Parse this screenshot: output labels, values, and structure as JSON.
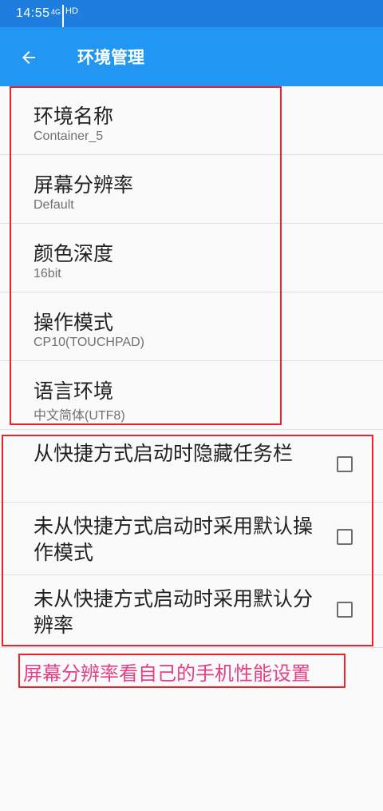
{
  "status_bar": {
    "time": "14:55",
    "network_label": "4G",
    "hd_label": "HD"
  },
  "app_bar": {
    "title": "环境管理",
    "back_icon": "arrow-left-icon"
  },
  "settings": [
    {
      "title": "环境名称",
      "value": "Container_5"
    },
    {
      "title": "屏幕分辨率",
      "value": "Default"
    },
    {
      "title": "颜色深度",
      "value": "16bit"
    },
    {
      "title": "操作模式",
      "value": "CP10(TOUCHPAD)"
    },
    {
      "title": "语言环境",
      "value": "中文简体(UTF8)"
    }
  ],
  "checkboxes": [
    {
      "label": "从快捷方式启动时隐藏任务栏",
      "checked": false
    },
    {
      "label": "未从快捷方式启动时采用默认操作模式",
      "checked": false
    },
    {
      "label": "未从快捷方式启动时采用默认分辨率",
      "checked": false
    }
  ],
  "annotation": {
    "text": "屏幕分辨率看自己的手机性能设置",
    "color": "#e63f86",
    "box_color": "#e8232d"
  },
  "colors": {
    "status_bar": "#1f7de0",
    "app_bar": "#2196f3",
    "background": "#fafafa"
  }
}
